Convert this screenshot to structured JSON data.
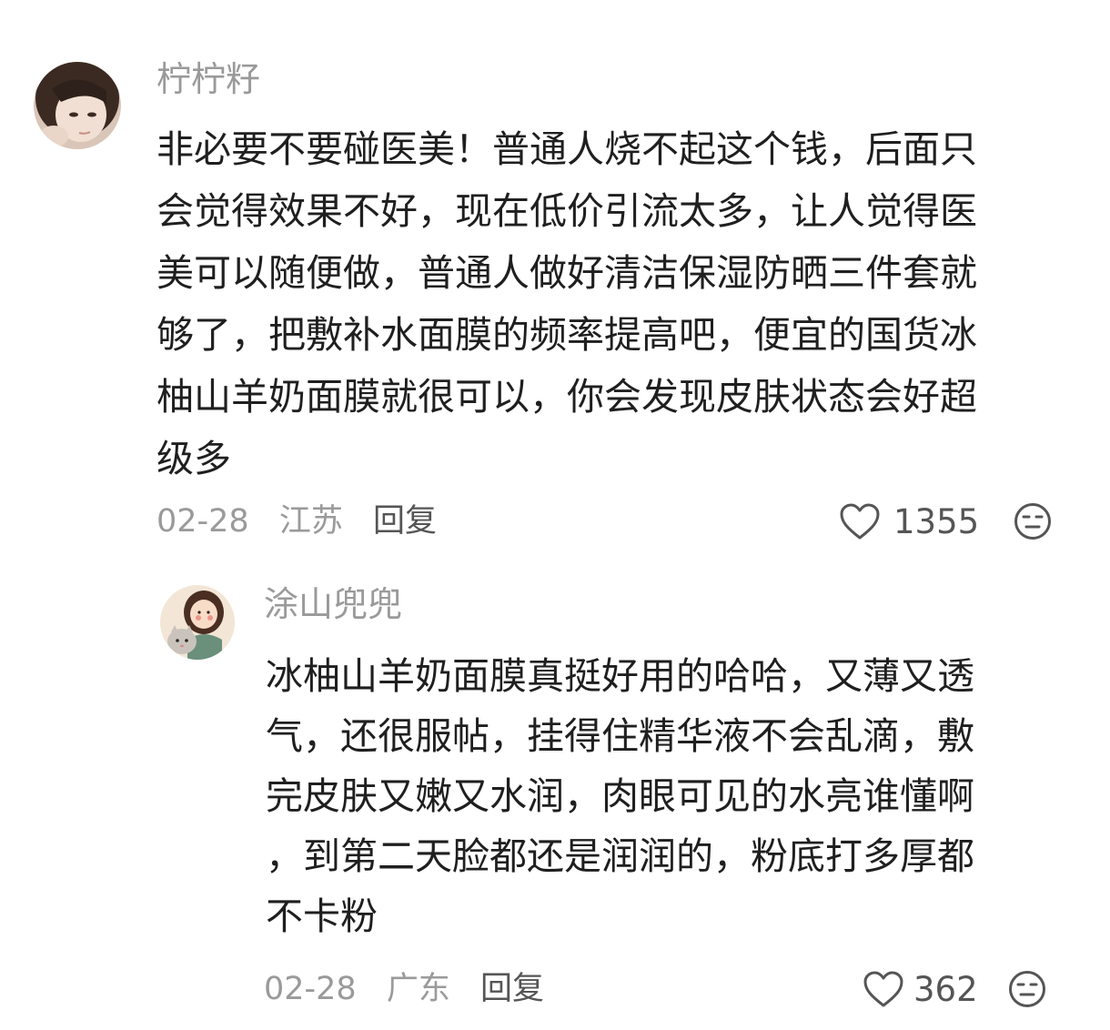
{
  "comments": [
    {
      "username": "柠柠籽",
      "body_lines": [
        "非必要不要碰医美！普通人烧不起这个钱，后面只",
        "会觉得效果不好，现在低价引流太多，让人觉得医",
        "美可以随便做，普通人做好清洁保湿防晒三件套就",
        "够了，把敷补水面膜的频率提高吧，便宜的国货冰",
        "柚山羊奶面膜就很可以，你会发现皮肤状态会好超",
        "级多"
      ],
      "date": "02-28",
      "location": "江苏",
      "reply_label": "回复",
      "like_count": "1355",
      "avatar_icon": "avatar-girl-photo",
      "like_icon": "heart-outline-icon",
      "reaction_icon": "neutral-face-icon"
    },
    {
      "username": "涂山兜兜",
      "body_lines": [
        "冰柚山羊奶面膜真挺好用的哈哈，又薄又透",
        "气，还很服帖，挂得住精华液不会乱滴，敷",
        "完皮肤又嫩又水润，肉眼可见的水亮谁懂啊",
        "，到第二天脸都还是润润的，粉底打多厚都",
        "不卡粉"
      ],
      "date": "02-28",
      "location": "广东",
      "reply_label": "回复",
      "like_count": "362",
      "avatar_icon": "avatar-illustrated-girl-with-cat",
      "like_icon": "heart-outline-icon",
      "reaction_icon": "neutral-face-icon"
    }
  ],
  "colors": {
    "meta_text": "#9a9a9a",
    "body_text": "#1f1f1f",
    "icon_stroke": "#555555"
  }
}
